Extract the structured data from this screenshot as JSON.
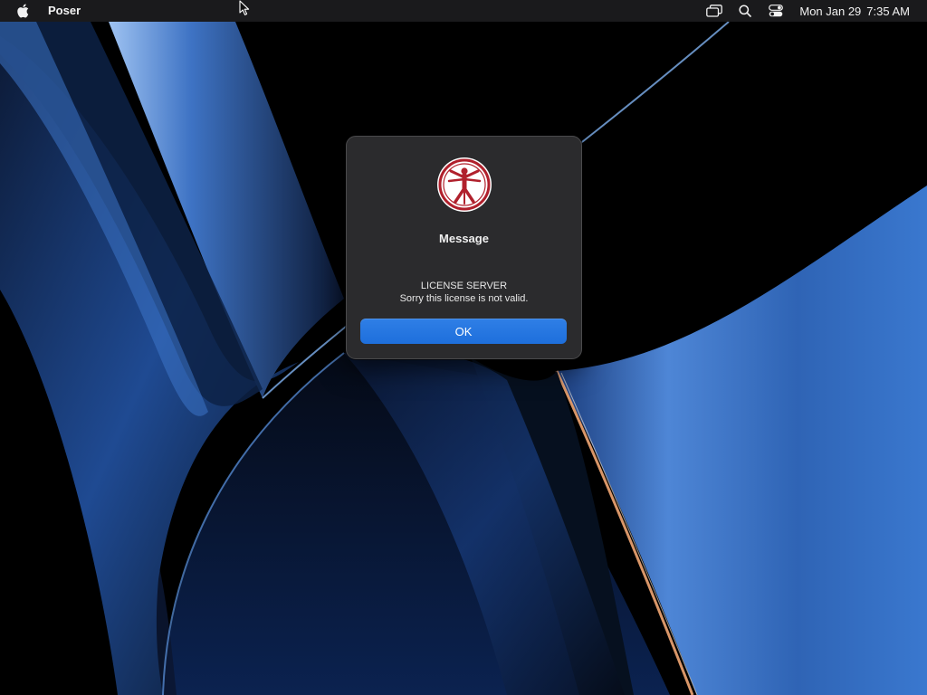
{
  "menubar": {
    "app_name": "Poser",
    "icons": [
      "apple-icon",
      "screen-mirroring-icon",
      "search-icon",
      "control-center-icon"
    ],
    "clock": {
      "date": "Mon Jan 29",
      "time": "7:35 AM"
    }
  },
  "dialog": {
    "icon": "poser-figure-icon",
    "title": "Message",
    "message_lines": [
      "LICENSE SERVER",
      "Sorry this license is not valid."
    ],
    "ok_label": "OK"
  },
  "colors": {
    "menubar_bg": "#1a1a1c",
    "dialog_bg": "#2b2b2d",
    "button_blue": "#1e6fdc",
    "logo_red": "#b0202c"
  }
}
